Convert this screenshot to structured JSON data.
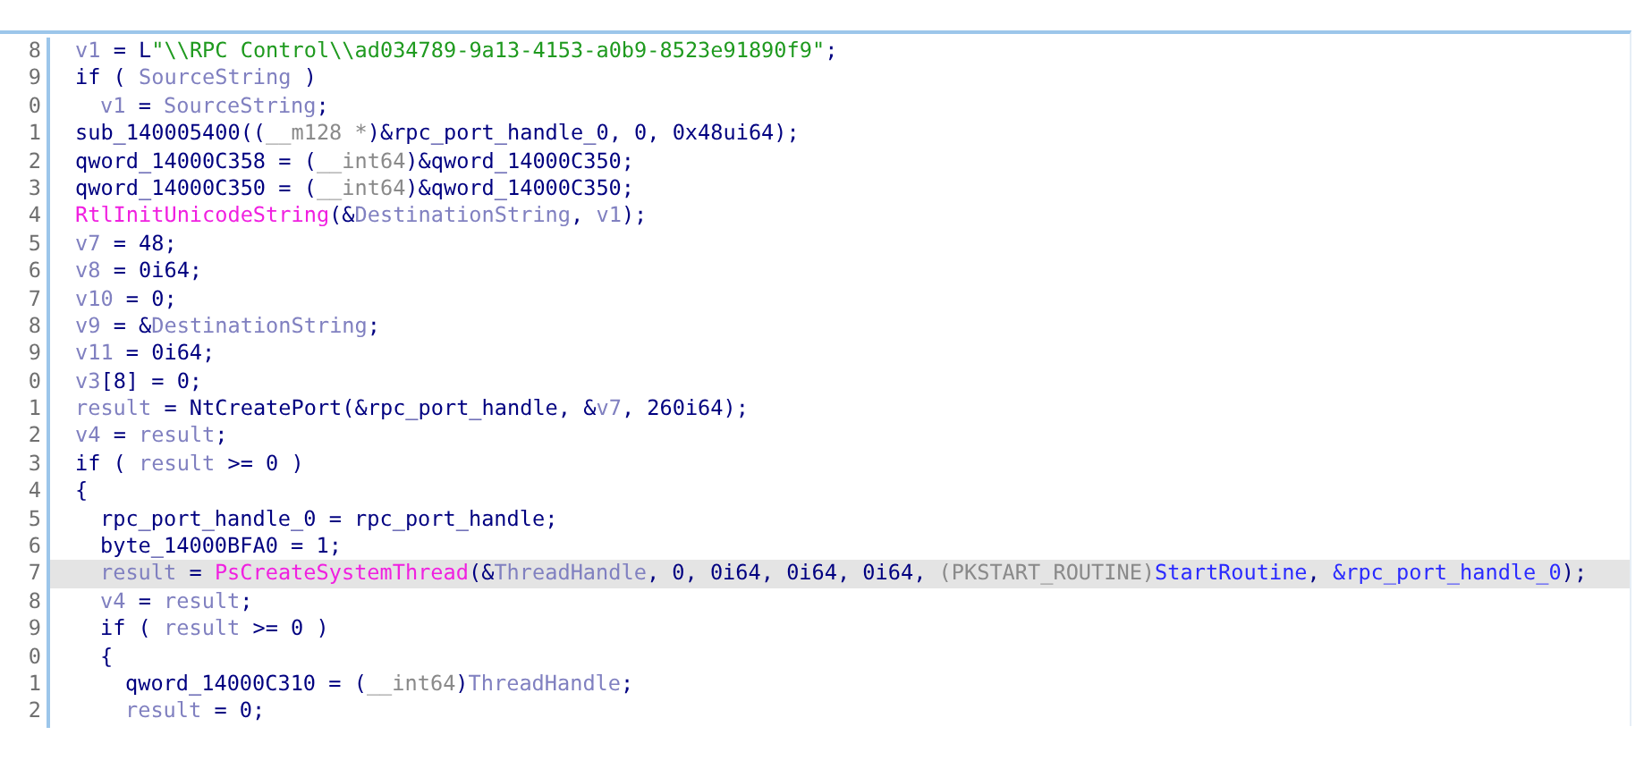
{
  "code_view": {
    "lines": [
      {
        "number": "8",
        "selected": false,
        "tokens": [
          {
            "kind": "var",
            "text": "v1"
          },
          {
            "kind": "plain",
            "text": " = L"
          },
          {
            "kind": "str",
            "text": "\"\\\\RPC Control\\\\ad034789-9a13-4153-a0b9-8523e91890f9\""
          },
          {
            "kind": "plain",
            "text": ";"
          }
        ]
      },
      {
        "number": "9",
        "selected": false,
        "tokens": [
          {
            "kind": "plain",
            "text": "if ( "
          },
          {
            "kind": "var",
            "text": "SourceString"
          },
          {
            "kind": "plain",
            "text": " )"
          }
        ],
        "children": [
          {
            "number": "0",
            "selected": false,
            "tokens": [
              {
                "kind": "var",
                "text": "v1"
              },
              {
                "kind": "plain",
                "text": " = "
              },
              {
                "kind": "var",
                "text": "SourceString"
              },
              {
                "kind": "plain",
                "text": ";"
              }
            ]
          }
        ]
      },
      {
        "number": "1",
        "selected": false,
        "tokens": [
          {
            "kind": "plain",
            "text": "sub_140005400(("
          },
          {
            "kind": "type",
            "text": "__m128 *"
          },
          {
            "kind": "plain",
            "text": ")&rpc_port_handle_0, 0, 0x48ui64);"
          }
        ]
      },
      {
        "number": "2",
        "selected": false,
        "tokens": [
          {
            "kind": "plain",
            "text": "qword_14000C358 = ("
          },
          {
            "kind": "type",
            "text": "__int64"
          },
          {
            "kind": "plain",
            "text": ")&qword_14000C350;"
          }
        ]
      },
      {
        "number": "3",
        "selected": false,
        "tokens": [
          {
            "kind": "plain",
            "text": "qword_14000C350 = ("
          },
          {
            "kind": "type",
            "text": "__int64"
          },
          {
            "kind": "plain",
            "text": ")&qword_14000C350;"
          }
        ]
      },
      {
        "number": "4",
        "selected": false,
        "tokens": [
          {
            "kind": "api",
            "text": "RtlInitUnicodeString"
          },
          {
            "kind": "plain",
            "text": "(&"
          },
          {
            "kind": "var",
            "text": "DestinationString"
          },
          {
            "kind": "plain",
            "text": ", "
          },
          {
            "kind": "var",
            "text": "v1"
          },
          {
            "kind": "plain",
            "text": ");"
          }
        ]
      },
      {
        "number": "5",
        "selected": false,
        "tokens": [
          {
            "kind": "var",
            "text": "v7"
          },
          {
            "kind": "plain",
            "text": " = 48;"
          }
        ]
      },
      {
        "number": "6",
        "selected": false,
        "tokens": [
          {
            "kind": "var",
            "text": "v8"
          },
          {
            "kind": "plain",
            "text": " = 0i64;"
          }
        ]
      },
      {
        "number": "7",
        "selected": false,
        "tokens": [
          {
            "kind": "var",
            "text": "v10"
          },
          {
            "kind": "plain",
            "text": " = 0;"
          }
        ]
      },
      {
        "number": "8",
        "selected": false,
        "tokens": [
          {
            "kind": "var",
            "text": "v9"
          },
          {
            "kind": "plain",
            "text": " = &"
          },
          {
            "kind": "var",
            "text": "DestinationString"
          },
          {
            "kind": "plain",
            "text": ";"
          }
        ]
      },
      {
        "number": "9",
        "selected": false,
        "tokens": [
          {
            "kind": "var",
            "text": "v11"
          },
          {
            "kind": "plain",
            "text": " = 0i64;"
          }
        ]
      },
      {
        "number": "0",
        "selected": false,
        "tokens": [
          {
            "kind": "var",
            "text": "v3"
          },
          {
            "kind": "plain",
            "text": "[8] = 0;"
          }
        ]
      },
      {
        "number": "1",
        "selected": false,
        "tokens": [
          {
            "kind": "var",
            "text": "result"
          },
          {
            "kind": "plain",
            "text": " = NtCreatePort(&rpc_port_handle, &"
          },
          {
            "kind": "var",
            "text": "v7"
          },
          {
            "kind": "plain",
            "text": ", 260i64);"
          }
        ]
      },
      {
        "number": "2",
        "selected": false,
        "tokens": [
          {
            "kind": "var",
            "text": "v4"
          },
          {
            "kind": "plain",
            "text": " = "
          },
          {
            "kind": "var",
            "text": "result"
          },
          {
            "kind": "plain",
            "text": ";"
          }
        ]
      },
      {
        "number": "3",
        "selected": false,
        "tokens": [
          {
            "kind": "plain",
            "text": "if ( "
          },
          {
            "kind": "var",
            "text": "result"
          },
          {
            "kind": "plain",
            "text": " >= 0 )"
          }
        ]
      },
      {
        "number": "4",
        "selected": false,
        "tokens": [
          {
            "kind": "plain",
            "text": "{"
          }
        ],
        "children": [
          {
            "number": "5",
            "selected": false,
            "tokens": [
              {
                "kind": "plain",
                "text": "rpc_port_handle_0 = rpc_port_handle;"
              }
            ]
          },
          {
            "number": "6",
            "selected": false,
            "tokens": [
              {
                "kind": "plain",
                "text": "byte_14000BFA0 = 1;"
              }
            ]
          },
          {
            "number": "7",
            "selected": true,
            "tokens": [
              {
                "kind": "var",
                "text": "result"
              },
              {
                "kind": "plain",
                "text": " = "
              },
              {
                "kind": "api",
                "text": "PsCreateSystemThread"
              },
              {
                "kind": "plain",
                "text": "(&"
              },
              {
                "kind": "var",
                "text": "ThreadHandle"
              },
              {
                "kind": "plain",
                "text": ", 0, 0i64, 0i64, 0i64, "
              },
              {
                "kind": "type",
                "text": "(PKSTART_ROUTINE)"
              },
              {
                "kind": "ref",
                "text": "StartRoutine"
              },
              {
                "kind": "plain",
                "text": ", "
              },
              {
                "kind": "ref",
                "text": "&rpc_port_handle_0"
              },
              {
                "kind": "plain",
                "text": ");"
              }
            ]
          },
          {
            "number": "8",
            "selected": false,
            "tokens": [
              {
                "kind": "var",
                "text": "v4"
              },
              {
                "kind": "plain",
                "text": " = "
              },
              {
                "kind": "var",
                "text": "result"
              },
              {
                "kind": "plain",
                "text": ";"
              }
            ]
          },
          {
            "number": "9",
            "selected": false,
            "tokens": [
              {
                "kind": "plain",
                "text": "if ( "
              },
              {
                "kind": "var",
                "text": "result"
              },
              {
                "kind": "plain",
                "text": " >= 0 )"
              }
            ]
          },
          {
            "number": "0",
            "selected": false,
            "tokens": [
              {
                "kind": "plain",
                "text": "{"
              }
            ],
            "children": [
              {
                "number": "1",
                "selected": false,
                "tokens": [
                  {
                    "kind": "plain",
                    "text": "qword_14000C310 = ("
                  },
                  {
                    "kind": "type",
                    "text": "__int64"
                  },
                  {
                    "kind": "plain",
                    "text": ")"
                  },
                  {
                    "kind": "var",
                    "text": "ThreadHandle"
                  },
                  {
                    "kind": "plain",
                    "text": ";"
                  }
                ]
              },
              {
                "number": "2",
                "selected": false,
                "tokens": [
                  {
                    "kind": "var",
                    "text": "result"
                  },
                  {
                    "kind": "plain",
                    "text": " = 0;"
                  }
                ]
              }
            ]
          }
        ]
      }
    ]
  }
}
